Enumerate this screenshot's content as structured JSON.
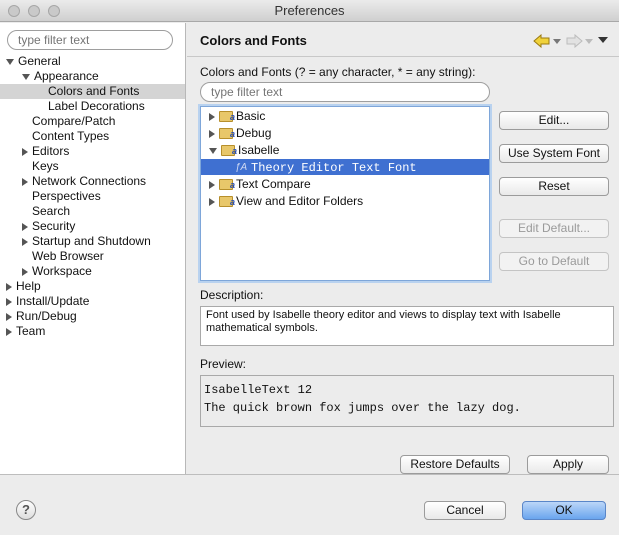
{
  "window": {
    "title": "Preferences"
  },
  "sidebar": {
    "filter_placeholder": "type filter text",
    "tree": [
      {
        "label": "General",
        "level": 0,
        "twisty": "open"
      },
      {
        "label": "Appearance",
        "level": 1,
        "twisty": "open"
      },
      {
        "label": "Colors and Fonts",
        "level": 2,
        "twisty": "none",
        "selected": true
      },
      {
        "label": "Label Decorations",
        "level": 2,
        "twisty": "none"
      },
      {
        "label": "Compare/Patch",
        "level": 1,
        "twisty": "none"
      },
      {
        "label": "Content Types",
        "level": 1,
        "twisty": "none"
      },
      {
        "label": "Editors",
        "level": 1,
        "twisty": "closed"
      },
      {
        "label": "Keys",
        "level": 1,
        "twisty": "none"
      },
      {
        "label": "Network Connections",
        "level": 1,
        "twisty": "closed"
      },
      {
        "label": "Perspectives",
        "level": 1,
        "twisty": "none"
      },
      {
        "label": "Search",
        "level": 1,
        "twisty": "none"
      },
      {
        "label": "Security",
        "level": 1,
        "twisty": "closed"
      },
      {
        "label": "Startup and Shutdown",
        "level": 1,
        "twisty": "closed"
      },
      {
        "label": "Web Browser",
        "level": 1,
        "twisty": "none"
      },
      {
        "label": "Workspace",
        "level": 1,
        "twisty": "closed"
      },
      {
        "label": "Help",
        "level": 0,
        "twisty": "closed"
      },
      {
        "label": "Install/Update",
        "level": 0,
        "twisty": "closed"
      },
      {
        "label": "Run/Debug",
        "level": 0,
        "twisty": "closed"
      },
      {
        "label": "Team",
        "level": 0,
        "twisty": "closed"
      }
    ]
  },
  "page": {
    "title": "Colors and Fonts",
    "filter_label": "Colors and Fonts (? = any character, * = any string):",
    "filter_placeholder": "type filter text",
    "font_tree": [
      {
        "label": "Basic",
        "kind": "folder",
        "twisty": "closed"
      },
      {
        "label": "Debug",
        "kind": "folder",
        "twisty": "closed"
      },
      {
        "label": "Isabelle",
        "kind": "folder",
        "twisty": "open"
      },
      {
        "label": "Theory Editor Text Font",
        "kind": "font",
        "twisty": "none",
        "selected": true
      },
      {
        "label": "Text Compare",
        "kind": "folder",
        "twisty": "closed"
      },
      {
        "label": "View and Editor Folders",
        "kind": "folder",
        "twisty": "closed"
      }
    ],
    "buttons": {
      "edit": "Edit...",
      "use_system_font": "Use System Font",
      "reset": "Reset",
      "edit_default": "Edit Default...",
      "go_to_default": "Go to Default"
    },
    "description_label": "Description:",
    "description_text": "Font used by Isabelle theory editor and views to display text with Isabelle mathematical symbols.",
    "preview_label": "Preview:",
    "preview_lines": [
      "IsabelleText 12",
      "The quick brown fox jumps over the lazy dog."
    ],
    "restore_defaults": "Restore Defaults",
    "apply": "Apply"
  },
  "footer": {
    "help": "?",
    "cancel": "Cancel",
    "ok": "OK"
  },
  "colors": {
    "selection": "#3f70d1",
    "sidebar_selection": "#d4d4d4",
    "focus_ring": "#7ea6d9"
  }
}
